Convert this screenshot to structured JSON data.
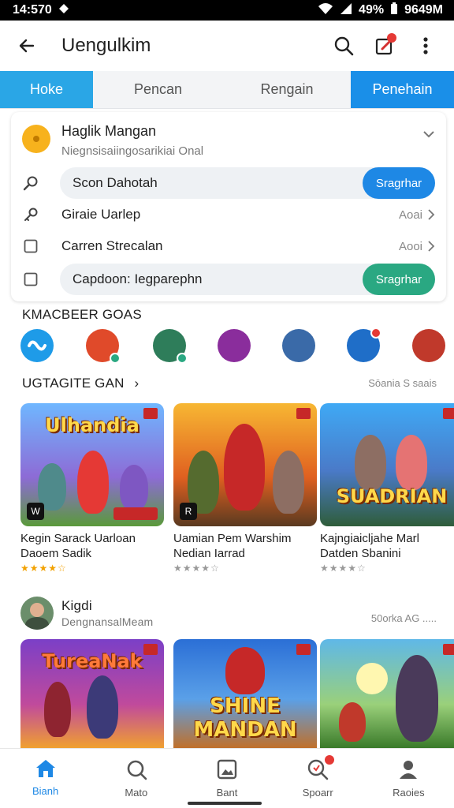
{
  "status_bar": {
    "time": "14:570",
    "battery": "49%",
    "right_text": "9649M"
  },
  "app_bar": {
    "title": "Uengulkim"
  },
  "tabs": [
    {
      "label": "Hoke"
    },
    {
      "label": "Pencan"
    },
    {
      "label": "Rengain"
    },
    {
      "label": "Penehain"
    }
  ],
  "card": {
    "title": "Haglik Mangan",
    "subtitle": "Niegnsisaiingosarikiai Onal",
    "rows": [
      {
        "label": "Scon Dahotah",
        "button": "Sragrhar"
      },
      {
        "label": "Giraie Uarlep",
        "meta": "Aoai"
      },
      {
        "label": "Carren Strecalan",
        "meta": "Aooi"
      },
      {
        "label": "Capdoon: Iegparephn",
        "button": "Sragrhar"
      }
    ]
  },
  "section1": {
    "title": "KMACBEER GOAS"
  },
  "avatars": [
    {
      "name": "app-1",
      "color": "#1e9be8"
    },
    {
      "name": "app-2",
      "color": "#e04a2a"
    },
    {
      "name": "app-3",
      "color": "#2e7d5a"
    },
    {
      "name": "app-4",
      "color": "#8a2d9c"
    },
    {
      "name": "app-5",
      "color": "#3a6aa8"
    },
    {
      "name": "app-6",
      "color": "#1f6ec8"
    },
    {
      "name": "app-7",
      "color": "#c0392b"
    }
  ],
  "section2": {
    "title": "UGTAGITE GAN",
    "right": "Sōania S saais"
  },
  "games": [
    {
      "logo": "Ulhandia",
      "name": "Kegin Sarack Uarloan Daoem Sadik",
      "stars": "★★★★☆"
    },
    {
      "logo": "",
      "name": "Uamian Pem Warshim Nedian Iarrad",
      "stars": "★★★★☆"
    },
    {
      "logo": "SUADRIAN",
      "name": "Kajngiaicljahe Marl Datden Sbanini",
      "stars": "★★★★☆"
    }
  ],
  "section3": {
    "title": "Kigdi",
    "subtitle": "DengnansalMeam",
    "right": "50orka AG ....."
  },
  "games2": [
    {
      "logo": "TureaNak"
    },
    {
      "logo": "SHINE MANDAN"
    },
    {
      "logo": ""
    }
  ],
  "bottom_nav": [
    {
      "label": "Bianh",
      "icon": "home-icon"
    },
    {
      "label": "Mato",
      "icon": "search-icon"
    },
    {
      "label": "Bant",
      "icon": "image-icon"
    },
    {
      "label": "Spoarr",
      "icon": "chat-search-icon"
    },
    {
      "label": "Raoies",
      "icon": "profile-icon"
    }
  ],
  "colors": {
    "accent": "#1e88e5",
    "tab_active": "#2aa6e6",
    "green_button": "#2aa882"
  }
}
